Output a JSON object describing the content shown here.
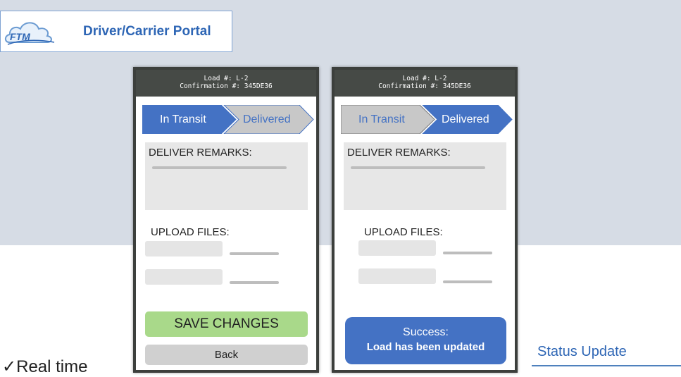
{
  "brand": {
    "logo_text": "FTM",
    "title": "Driver/Carrier Portal"
  },
  "phones": [
    {
      "header": {
        "load": "Load #: L-2",
        "confirmation": "Confirmation #: 345DE36"
      },
      "steps": [
        {
          "label": "In Transit",
          "active": true
        },
        {
          "label": "Delivered",
          "active": false
        }
      ],
      "remarks_label": "DELIVER REMARKS:",
      "upload_label": "UPLOAD FILES:",
      "save_label": "SAVE CHANGES",
      "back_label": "Back"
    },
    {
      "header": {
        "load": "Load #: L-2",
        "confirmation": "Confirmation #: 345DE36"
      },
      "steps": [
        {
          "label": "In Transit",
          "active": false
        },
        {
          "label": "Delivered",
          "active": true
        }
      ],
      "remarks_label": "DELIVER REMARKS:",
      "upload_label": "UPLOAD FILES:",
      "success_title": "Success:",
      "success_message": "Load has been updated"
    }
  ],
  "feature": {
    "check": "✓",
    "text": "Real time"
  },
  "caption": "Status Update",
  "colors": {
    "active_step": "#4472c4",
    "inactive_step": "#c8c8c8",
    "save": "#a9d98a",
    "success": "#4472c4",
    "brand_blue": "#2e66b5"
  }
}
